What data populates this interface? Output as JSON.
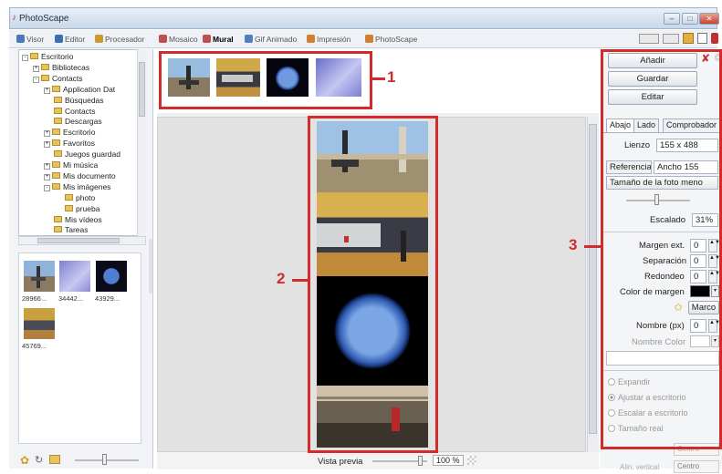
{
  "window": {
    "title": "PhotoScape",
    "controls": {
      "minimize": "–",
      "maximize": "□",
      "close": "✕"
    }
  },
  "tabs": [
    {
      "label": "Visor",
      "color": "#4a78b8",
      "active": false
    },
    {
      "label": "Editor",
      "color": "#3b6fb0",
      "active": false
    },
    {
      "label": "Procesador",
      "color": "#c89a30",
      "active": false
    },
    {
      "label": "Mosaico",
      "color": "#c05050",
      "active": false
    },
    {
      "label": "Mural",
      "color": "#c05050",
      "active": true
    },
    {
      "label": "Gif Animado",
      "color": "#5080c0",
      "active": false
    },
    {
      "label": "Impresión",
      "color": "#d08030",
      "active": false
    },
    {
      "label": "PhotoScape",
      "color": "#d08030",
      "active": false
    }
  ],
  "tree": [
    {
      "label": "Escritorio",
      "depth": 0,
      "exp": "-"
    },
    {
      "label": "Bibliotecas",
      "depth": 1,
      "exp": "+"
    },
    {
      "label": "Contacts",
      "depth": 1,
      "exp": "-"
    },
    {
      "label": "Application Dat",
      "depth": 2,
      "exp": "+"
    },
    {
      "label": "Búsquedas",
      "depth": 2,
      "exp": ""
    },
    {
      "label": "Contacts",
      "depth": 2,
      "exp": ""
    },
    {
      "label": "Descargas",
      "depth": 2,
      "exp": ""
    },
    {
      "label": "Escritorio",
      "depth": 2,
      "exp": "+"
    },
    {
      "label": "Favoritos",
      "depth": 2,
      "exp": "+"
    },
    {
      "label": "Juegos guardad",
      "depth": 2,
      "exp": ""
    },
    {
      "label": "Mi música",
      "depth": 2,
      "exp": "+"
    },
    {
      "label": "Mis documento",
      "depth": 2,
      "exp": "+"
    },
    {
      "label": "Mis imágenes",
      "depth": 2,
      "exp": "-"
    },
    {
      "label": "photo",
      "depth": 3,
      "exp": ""
    },
    {
      "label": "prueba",
      "depth": 3,
      "exp": ""
    },
    {
      "label": "Mis vídeos",
      "depth": 2,
      "exp": ""
    },
    {
      "label": "Tareas",
      "depth": 2,
      "exp": ""
    }
  ],
  "left_thumbs": [
    {
      "label": "28966..."
    },
    {
      "label": "34442..."
    },
    {
      "label": "43929..."
    },
    {
      "label": "45769..."
    }
  ],
  "callouts": {
    "one": "1",
    "two": "2",
    "three": "3"
  },
  "status": {
    "preview_label": "Vista previa",
    "zoom": "100 %"
  },
  "right": {
    "add_button": "Añadir",
    "save_button": "Guardar",
    "edit_button": "Editar",
    "tabs": [
      "Abajo",
      "Lado",
      "Comprobador"
    ],
    "canvas_label": "Lienzo",
    "canvas_value": "155 x 488",
    "reference_label": "Referencia",
    "reference_value": "Ancho 155",
    "size_select": "Tamaño de la foto meno",
    "scale_label": "Escalado",
    "scale_value": "31%",
    "outer_margin_label": "Margen ext.",
    "outer_margin_value": "0",
    "separation_label": "Separación",
    "separation_value": "0",
    "rounding_label": "Redondeo",
    "rounding_value": "0",
    "margin_color_label": "Color de margen",
    "margin_color": "#000000",
    "frame_button": "Marco",
    "name_label": "Nombre (px)",
    "name_value": "0",
    "name_color_label": "Nombre Color",
    "radios": [
      {
        "label": "Expandir",
        "selected": false
      },
      {
        "label": "Ajustar a escritorio",
        "selected": true
      },
      {
        "label": "Escalar a escritorio",
        "selected": false
      },
      {
        "label": "Tamaño real",
        "selected": false
      }
    ],
    "bottom_select": "Centro",
    "bottom_label": "Alin. vertical"
  },
  "colors": {
    "callout": "#d32b2b"
  }
}
